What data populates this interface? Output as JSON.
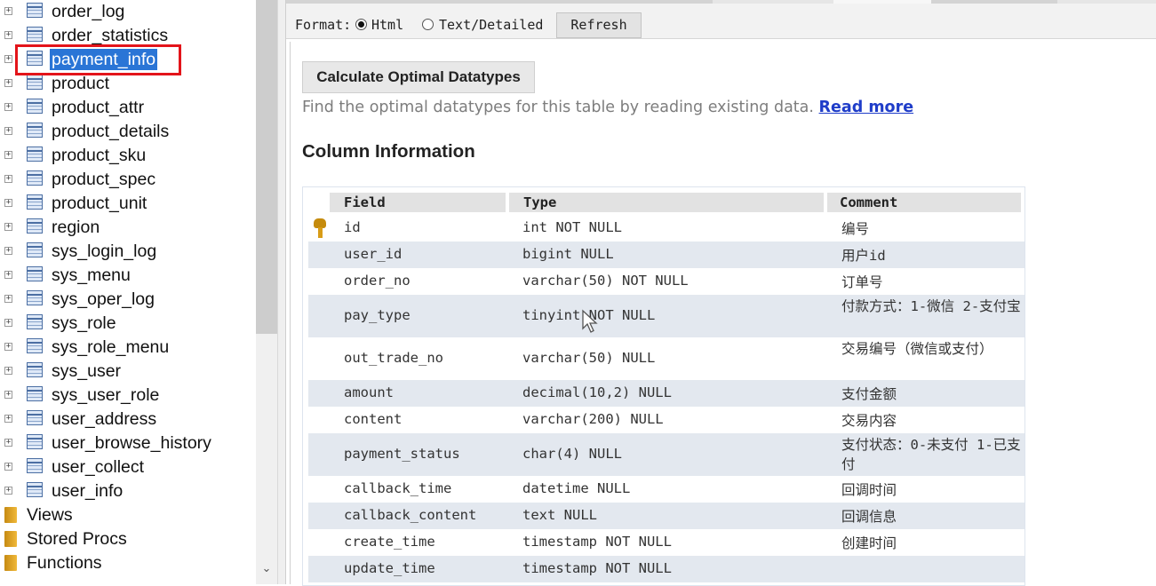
{
  "tree": {
    "tables": [
      {
        "label": "order_log",
        "selected": false
      },
      {
        "label": "order_statistics",
        "selected": false
      },
      {
        "label": "payment_info",
        "selected": true
      },
      {
        "label": "product",
        "selected": false
      },
      {
        "label": "product_attr",
        "selected": false
      },
      {
        "label": "product_details",
        "selected": false
      },
      {
        "label": "product_sku",
        "selected": false
      },
      {
        "label": "product_spec",
        "selected": false
      },
      {
        "label": "product_unit",
        "selected": false
      },
      {
        "label": "region",
        "selected": false
      },
      {
        "label": "sys_login_log",
        "selected": false
      },
      {
        "label": "sys_menu",
        "selected": false
      },
      {
        "label": "sys_oper_log",
        "selected": false
      },
      {
        "label": "sys_role",
        "selected": false
      },
      {
        "label": "sys_role_menu",
        "selected": false
      },
      {
        "label": "sys_user",
        "selected": false
      },
      {
        "label": "sys_user_role",
        "selected": false
      },
      {
        "label": "user_address",
        "selected": false
      },
      {
        "label": "user_browse_history",
        "selected": false
      },
      {
        "label": "user_collect",
        "selected": false
      },
      {
        "label": "user_info",
        "selected": false
      }
    ],
    "folders": [
      "Views",
      "Stored Procs",
      "Functions"
    ],
    "expander_symbol": "+",
    "scroll_down_symbol": "⌄",
    "highlight_color": "#e3141a",
    "selection_color": "#2a75d6"
  },
  "toolbar": {
    "format_label": "Format:",
    "option_html": "Html",
    "option_text": "Text/Detailed",
    "selected_option": "Html",
    "refresh_label": "Refresh"
  },
  "main": {
    "calc_button_label": "Calculate Optimal Datatypes",
    "calc_description": "Find the optimal datatypes for this table by reading existing data.",
    "read_more_link": "Read more",
    "section_title": "Column Information",
    "table": {
      "headers": [
        "Field",
        "Type",
        "Comment"
      ],
      "rows": [
        {
          "field": "id",
          "type": "int NOT NULL",
          "comment": "编号",
          "primary_key": true
        },
        {
          "field": "user_id",
          "type": "bigint NULL",
          "comment": "用户id"
        },
        {
          "field": "order_no",
          "type": "varchar(50) NOT NULL",
          "comment": "订单号"
        },
        {
          "field": "pay_type",
          "type": "tinyint NOT NULL",
          "comment": "付款方式：1-微信 2-支付宝"
        },
        {
          "field": "out_trade_no",
          "type": "varchar(50) NULL",
          "comment": "交易编号（微信或支付）"
        },
        {
          "field": "amount",
          "type": "decimal(10,2) NULL",
          "comment": "支付金额"
        },
        {
          "field": "content",
          "type": "varchar(200) NULL",
          "comment": "交易内容"
        },
        {
          "field": "payment_status",
          "type": "char(4) NULL",
          "comment": "支付状态：0-未支付 1-已支付"
        },
        {
          "field": "callback_time",
          "type": "datetime NULL",
          "comment": "回调时间"
        },
        {
          "field": "callback_content",
          "type": "text NULL",
          "comment": "回调信息"
        },
        {
          "field": "create_time",
          "type": "timestamp NOT NULL",
          "comment": "创建时间"
        },
        {
          "field": "update_time",
          "type": "timestamp NOT NULL",
          "comment": ""
        }
      ]
    }
  },
  "colors": {
    "link": "#1f3dc9",
    "row_alt": "#e3e8ef",
    "header_bg": "#e2e2e2",
    "key_icon": "#c58b0d"
  }
}
